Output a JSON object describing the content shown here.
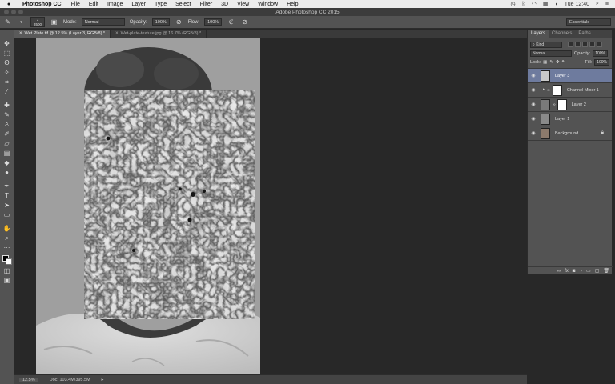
{
  "menubar": {
    "apple": "",
    "app_name": "Photoshop CC",
    "items": [
      "File",
      "Edit",
      "Image",
      "Layer",
      "Type",
      "Select",
      "Filter",
      "3D",
      "View",
      "Window",
      "Help"
    ],
    "time": "Tue 12:40"
  },
  "window": {
    "title": "Adobe Photoshop CC 2015"
  },
  "options": {
    "brush_size": "3500",
    "mode_label": "Mode:",
    "mode_value": "Normal",
    "opacity_label": "Opacity:",
    "opacity_value": "100%",
    "flow_label": "Flow:",
    "flow_value": "100%",
    "workspace": "Essentials"
  },
  "tabs": [
    {
      "label": "Wet Plate.tif @ 12.5% (Layer 3, RGB/8) *"
    },
    {
      "label": "Wet-plate-texture.jpg @ 16.7% (RGB/8) *"
    }
  ],
  "status": {
    "zoom": "12.5%",
    "doc": "Doc: 103.4M/395.5M"
  },
  "panel": {
    "tabs": [
      "Layers",
      "Channels",
      "Paths"
    ],
    "filter_kind": "Kind",
    "blend_mode": "Normal",
    "opacity_label": "Opacity:",
    "opacity_value": "100%",
    "lock_label": "Lock:",
    "fill_label": "Fill:",
    "fill_value": "100%",
    "layers": [
      {
        "name": "Layer 3"
      },
      {
        "name": "Channel Mixer 1"
      },
      {
        "name": "Layer 2"
      },
      {
        "name": "Layer 1"
      },
      {
        "name": "Background"
      }
    ]
  },
  "colors": {
    "selected_layer": "#6e7b9e",
    "panel_bg": "#535353",
    "canvas_bg": "#282828"
  }
}
